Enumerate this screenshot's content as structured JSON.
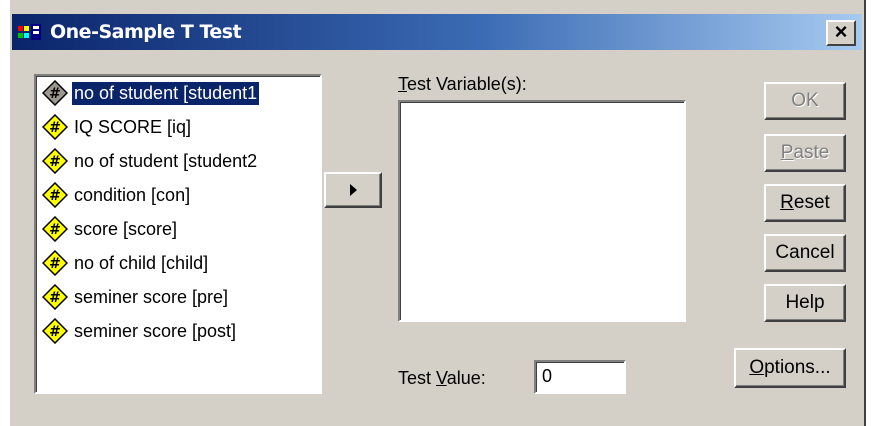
{
  "window": {
    "title": "One-Sample T Test",
    "close_glyph": "✕"
  },
  "variables": [
    {
      "label": "no of student [student1",
      "selected": true,
      "icon": "scale-variable-icon"
    },
    {
      "label": "IQ SCORE [iq]",
      "selected": false,
      "icon": "scale-variable-icon"
    },
    {
      "label": "no of student [student2",
      "selected": false,
      "icon": "scale-variable-icon"
    },
    {
      "label": "condition [con]",
      "selected": false,
      "icon": "scale-variable-icon"
    },
    {
      "label": "score [score]",
      "selected": false,
      "icon": "scale-variable-icon"
    },
    {
      "label": "no of child [child]",
      "selected": false,
      "icon": "scale-variable-icon"
    },
    {
      "label": "seminer score [pre]",
      "selected": false,
      "icon": "scale-variable-icon"
    },
    {
      "label": "seminer score [post]",
      "selected": false,
      "icon": "scale-variable-icon"
    }
  ],
  "test_variables": {
    "label_mnemonic": "T",
    "label_rest": "est Variable(s):",
    "items": []
  },
  "test_value": {
    "label_pre": "Test ",
    "label_mnemonic": "V",
    "label_post": "alue:",
    "value": "0"
  },
  "buttons": {
    "ok": "OK",
    "paste_mnemonic": "P",
    "paste_rest": "aste",
    "reset_mnemonic": "R",
    "reset_rest": "eset",
    "cancel": "Cancel",
    "help": "Help",
    "options_mnemonic": "O",
    "options_rest": "ptions..."
  },
  "colors": {
    "dialog_face": "#d4d0c8",
    "titlebar_start": "#0a246a",
    "titlebar_end": "#a6caf0",
    "selection": "#0a246a",
    "disabled_text": "#808080"
  }
}
